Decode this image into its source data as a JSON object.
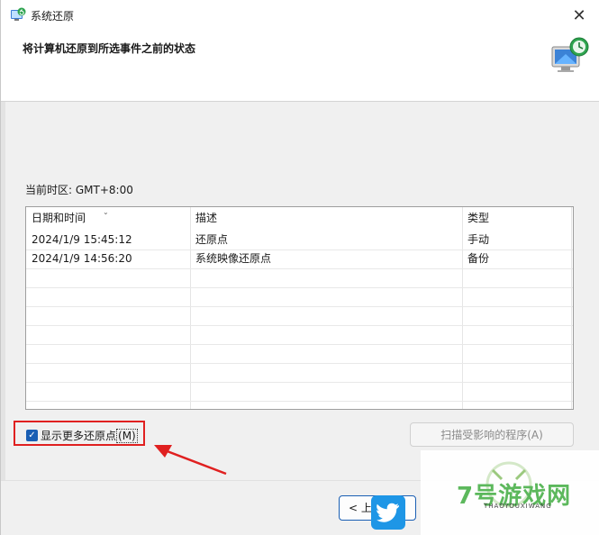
{
  "window": {
    "title": "系统还原",
    "icon": "system-restore-icon",
    "close_glyph": "✕"
  },
  "header": {
    "title": "将计算机还原到所选事件之前的状态",
    "icon": "monitor-restore-icon"
  },
  "timezone": {
    "label": "当前时区: GMT+8:00"
  },
  "table": {
    "columns": [
      "日期和时间",
      "描述",
      "类型"
    ],
    "sort_indicator": "⌄",
    "rows": [
      {
        "date": "2024/1/9 15:45:12",
        "description": "还原点",
        "type": "手动"
      },
      {
        "date": "2024/1/9 14:56:20",
        "description": "系统映像还原点",
        "type": "备份"
      }
    ]
  },
  "options": {
    "show_more_label": "显示更多还原点",
    "show_more_accel": "(M)",
    "show_more_checked": true,
    "check_glyph": "✓"
  },
  "buttons": {
    "scan_label": "扫描受影响的程序(A)",
    "back_label": "< 上一"
  },
  "annotation": {
    "highlight_color": "#e02020",
    "arrow_color": "#e02020"
  },
  "watermark": {
    "text": "7号游戏网",
    "sub": "THAOYOUXIWANG"
  },
  "colors": {
    "accent": "#1a5fb4",
    "twitter": "#1e96e6"
  }
}
